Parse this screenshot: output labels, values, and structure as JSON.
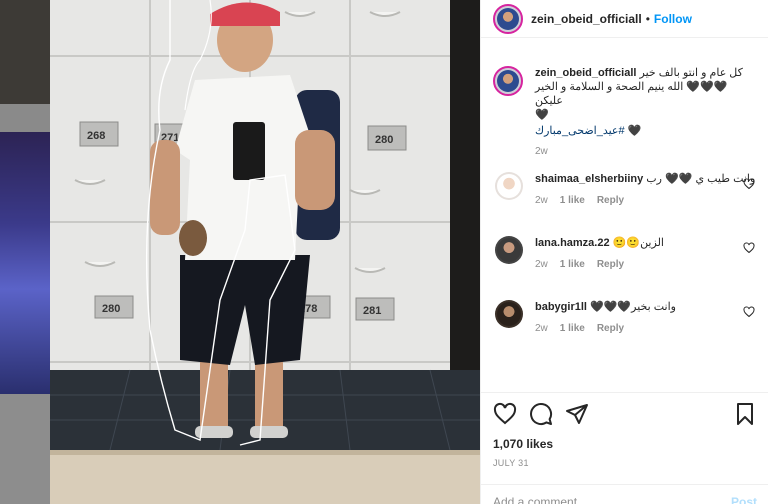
{
  "post": {
    "username": "zein_obeid_officiall",
    "separator": "•",
    "follow_label": "Follow",
    "caption_line1": "كل عام و انتو بالف خير",
    "caption_line2": "🖤🖤🖤 الله ينيم الصحة و السلامة و الخير عليكن",
    "caption_line3": "🖤",
    "caption_hashtag": "#عيد_اضحى_مبارك",
    "caption_hashtag_suffix": "🖤",
    "caption_age": "2w",
    "likes_total": "1,070 likes",
    "date": "JULY 31",
    "comment_placeholder": "Add a comment…",
    "post_label": "Post",
    "locker_numbers": [
      "268",
      "271",
      "280",
      "280",
      "278",
      "281"
    ]
  },
  "comments": [
    {
      "username": "shaimaa_elsherbiiny",
      "text": "وانت طيب ي 🖤🖤 رب",
      "age": "2w",
      "likes": "1 like",
      "reply_label": "Reply"
    },
    {
      "username": "lana.hamza.22",
      "text": "🙂🙂الزين",
      "age": "2w",
      "likes": "1 like",
      "reply_label": "Reply"
    },
    {
      "username": "babygir1ll",
      "text": "🖤🖤🖤وانت بخير",
      "age": "2w",
      "likes": "1 like",
      "reply_label": "Reply"
    }
  ],
  "colors": {
    "accent_blue": "#0095f6",
    "hashtag_blue": "#00376b",
    "muted_text": "#8e8e8e",
    "primary_text": "#262626",
    "post_disabled": "#b2dffc"
  },
  "icons": {
    "like": "heart-icon",
    "comment": "comment-bubble-icon",
    "share": "paper-plane-icon",
    "save": "bookmark-icon"
  }
}
